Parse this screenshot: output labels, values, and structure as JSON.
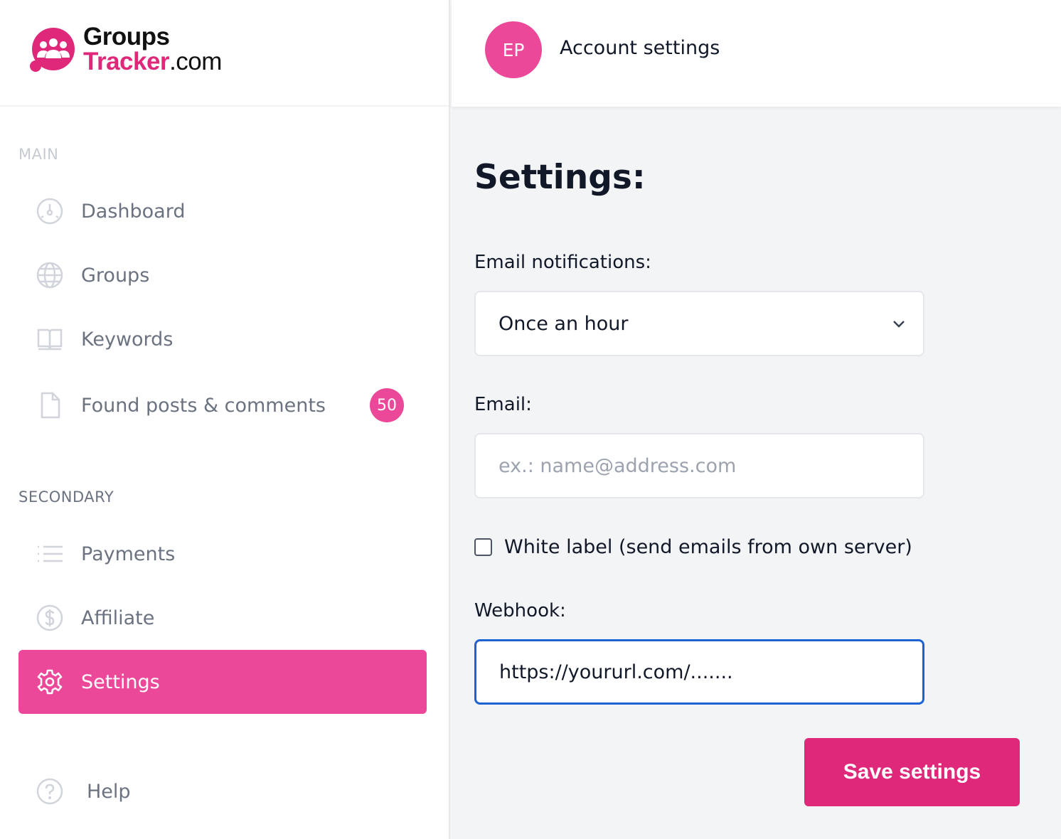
{
  "brand": {
    "line1": "Groups",
    "line2_brand": "Tracker",
    "line2_suffix": ".com",
    "color": "#e0287a"
  },
  "sidebar": {
    "main_label": "MAIN",
    "secondary_label": "SECONDARY",
    "main_items": [
      {
        "label": "Dashboard",
        "icon": "dashboard-icon"
      },
      {
        "label": "Groups",
        "icon": "globe-icon"
      },
      {
        "label": "Keywords",
        "icon": "book-icon"
      },
      {
        "label": "Found posts & comments",
        "icon": "document-icon",
        "badge": "50"
      }
    ],
    "secondary_items": [
      {
        "label": "Payments",
        "icon": "list-icon"
      },
      {
        "label": "Affiliate",
        "icon": "dollar-icon"
      },
      {
        "label": "Settings",
        "icon": "gear-icon",
        "active": true
      }
    ],
    "help_label": "Help"
  },
  "header": {
    "avatar_initials": "EP",
    "title": "Account settings"
  },
  "main": {
    "title": "Settings:",
    "email_notifications": {
      "label": "Email notifications:",
      "selected": "Once an hour"
    },
    "email": {
      "label": "Email:",
      "placeholder": "ex.: name@address.com",
      "value": ""
    },
    "white_label": {
      "label": "White label (send emails from own server)",
      "checked": false
    },
    "webhook": {
      "label": "Webhook:",
      "value": "https://yoururl.com/......."
    },
    "save_label": "Save settings"
  },
  "colors": {
    "accent": "#ec4899",
    "save_button": "#e0287a",
    "focus_border": "#1d63d4"
  }
}
